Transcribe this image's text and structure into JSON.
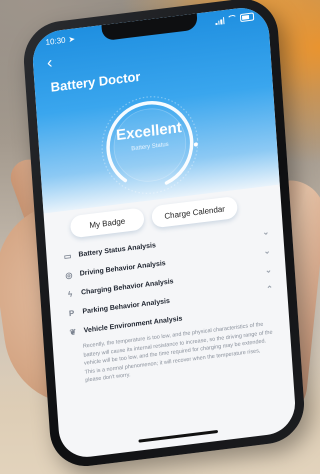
{
  "status_bar": {
    "time": "10:30"
  },
  "header": {
    "back_icon": "chevron-left-icon",
    "title": "Battery Doctor"
  },
  "gauge": {
    "status": "Excellent",
    "caption": "Battery Status"
  },
  "buttons": {
    "badge": "My Badge",
    "calendar": "Charge Calendar"
  },
  "analysis": {
    "items": [
      {
        "icon": "battery-icon",
        "label": "Battery Status Analysis",
        "state": "collapsed"
      },
      {
        "icon": "steering-wheel-icon",
        "label": "Driving Behavior Analysis",
        "state": "collapsed"
      },
      {
        "icon": "lightning-icon",
        "label": "Charging Behavior Analysis",
        "state": "collapsed"
      },
      {
        "icon": "parking-icon",
        "label": "Parking Behavior Analysis",
        "state": "expanded"
      },
      {
        "icon": "leaf-icon",
        "label": "Vehicle Environment Analysis",
        "state": "expanded"
      }
    ],
    "expanded_text": "Recently, the temperature is too low, and the physical characteristics of the battery will cause its internal resistance to increase, so the driving range of the vehicle will be too low, and the time required for charging may be extended. This is a normal phenomenon; it will recover when the temperature rises, please don't worry."
  }
}
